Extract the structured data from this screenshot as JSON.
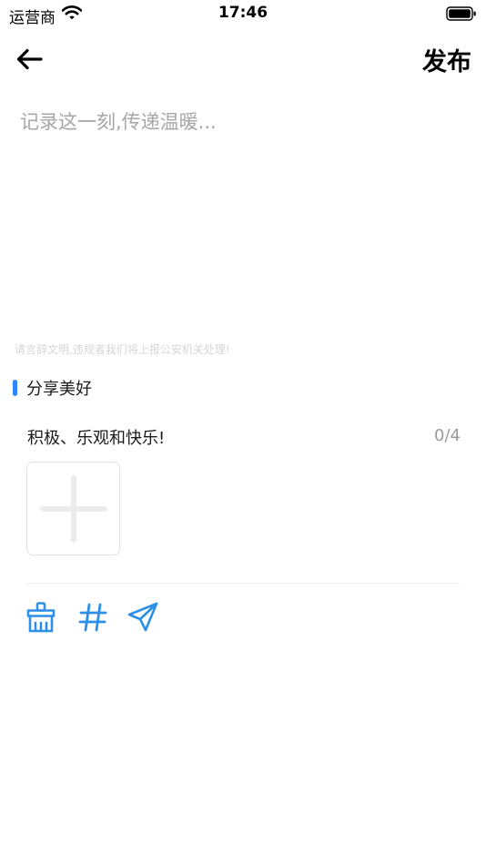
{
  "status_bar": {
    "carrier": "运营商",
    "time": "17:46"
  },
  "nav": {
    "back_icon": "arrow-left-icon",
    "publish_label": "发布"
  },
  "editor": {
    "placeholder": "记录这一刻,传递温暖...",
    "value": "",
    "notice": "请言辞文明,违规者我们将上报公安机关处理!"
  },
  "share": {
    "section_title": "分享美好",
    "prompt": "积极、乐观和快乐!",
    "image_count": "0/4",
    "add_icon": "plus-icon"
  },
  "toolbar": {
    "icons": [
      "broom-icon",
      "hashtag-icon",
      "paper-plane-icon"
    ]
  },
  "colors": {
    "accent": "#2f86ff",
    "tool_icon": "#2d8fe6",
    "placeholder": "#a6a6a6",
    "notice": "#d6d6d6"
  }
}
